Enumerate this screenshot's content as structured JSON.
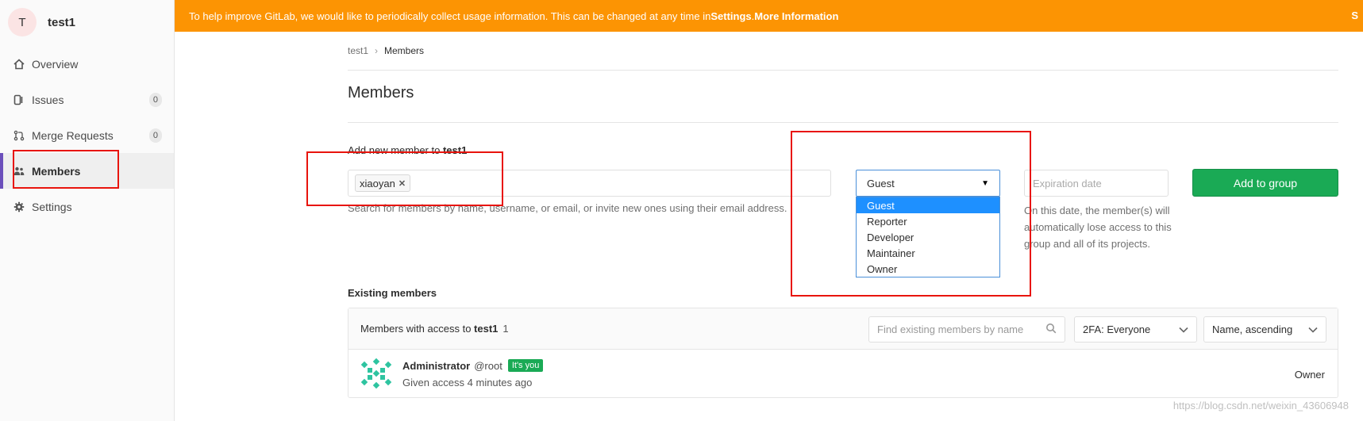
{
  "sidebar": {
    "group_initial": "T",
    "group_name": "test1",
    "items": [
      {
        "label": "Overview",
        "count": ""
      },
      {
        "label": "Issues",
        "count": "0"
      },
      {
        "label": "Merge Requests",
        "count": "0"
      },
      {
        "label": "Members",
        "count": ""
      },
      {
        "label": "Settings",
        "count": ""
      }
    ]
  },
  "banner": {
    "text": "To help improve GitLab, we would like to periodically collect usage information. This can be changed at any time in ",
    "settings_link": "Settings",
    "period": ". ",
    "more_info": "More Information",
    "close": "S"
  },
  "breadcrumb": {
    "parent": "test1",
    "current": "Members"
  },
  "page": {
    "title": "Members"
  },
  "add_member": {
    "label_prefix": "Add new member to ",
    "group": "test1",
    "token": "xiaoyan",
    "help": "Search for members by name, username, or email, or invite new ones using their email address.",
    "access_selected": "Guest",
    "access_options": [
      "Guest",
      "Reporter",
      "Developer",
      "Maintainer",
      "Owner"
    ],
    "expiration_placeholder": "Expiration date",
    "expiration_help": "On this date, the member(s) will automatically lose access to this group and all of its projects.",
    "button": "Add to group"
  },
  "existing": {
    "title": "Existing members",
    "head_prefix": "Members with access to ",
    "group": "test1",
    "count": "1",
    "search_placeholder": "Find existing members by name",
    "twofa": "2FA: Everyone",
    "sort": "Name, ascending",
    "members": [
      {
        "name": "Administrator",
        "handle": "@root",
        "badge": "It's you",
        "given": "Given access 4 minutes ago",
        "role": "Owner"
      }
    ]
  },
  "watermark": "https://blog.csdn.net/weixin_43606948",
  "colors": {
    "banner": "#fc9403",
    "accent": "#6b4fbb",
    "success": "#1aaa55",
    "annotation": "#e8140c"
  }
}
